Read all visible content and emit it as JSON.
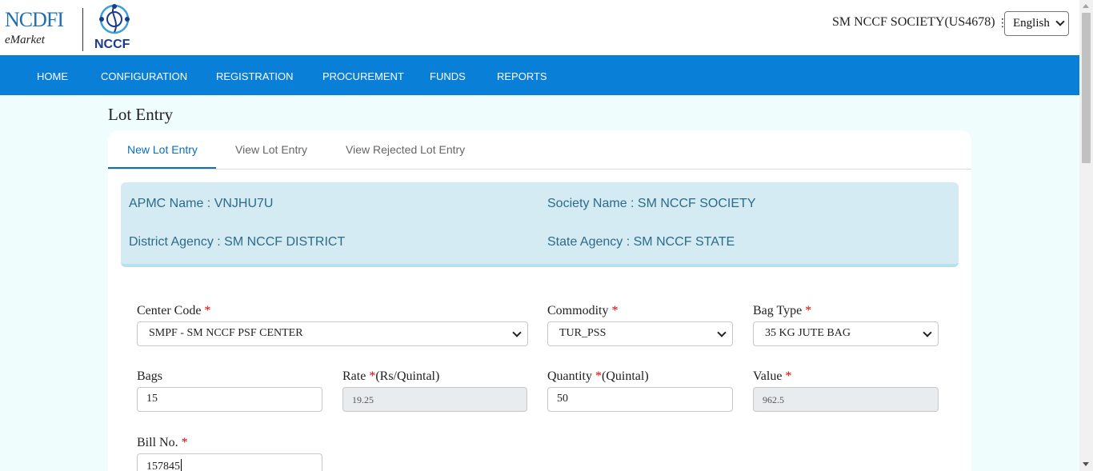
{
  "header": {
    "logo_ncdfi_line1": "NCDFI",
    "logo_ncdfi_line2": "eMarket",
    "logo_nccf_text": "NCCF",
    "user_label": "SM NCCF SOCIETY(US4678)",
    "language": "English"
  },
  "nav": {
    "items": [
      "HOME",
      "CONFIGURATION",
      "REGISTRATION",
      "PROCUREMENT",
      "FUNDS",
      "REPORTS"
    ]
  },
  "page": {
    "title": "Lot Entry",
    "tabs": [
      "New Lot Entry",
      "View Lot Entry",
      "View Rejected Lot Entry"
    ],
    "active_tab": "New Lot Entry"
  },
  "info": {
    "apmc": "APMC Name : VNJHU7U",
    "society": "Society Name : SM NCCF SOCIETY",
    "district": "District Agency : SM NCCF DISTRICT",
    "state": "State Agency : SM NCCF STATE"
  },
  "form": {
    "center_code": {
      "label": "Center Code ",
      "required": "*",
      "value": "SMPF - SM NCCF PSF CENTER"
    },
    "commodity": {
      "label": "Commodity ",
      "required": "*",
      "value": "TUR_PSS"
    },
    "bag_type": {
      "label": "Bag Type ",
      "required": "*",
      "value": "35 KG JUTE BAG"
    },
    "bags": {
      "label": "Bags",
      "value": "15"
    },
    "rate": {
      "label": "Rate ",
      "required": "*",
      "unit": "(Rs/Quintal)",
      "value": "19.25"
    },
    "quantity": {
      "label": "Quantity ",
      "required": "*",
      "unit": "(Quintal)",
      "value": "50"
    },
    "value": {
      "label": "Value ",
      "required": "*",
      "value": "962.5"
    },
    "bill_no": {
      "label": "Bill No. ",
      "required": "*",
      "value": "157845"
    }
  },
  "colors": {
    "nav_bg": "#0a7fd8",
    "page_bg": "#f0fdfd",
    "info_bg": "#d4ebf3",
    "info_text": "#2d6b87",
    "required": "#e00000",
    "active_tab": "#0a6fbf"
  }
}
